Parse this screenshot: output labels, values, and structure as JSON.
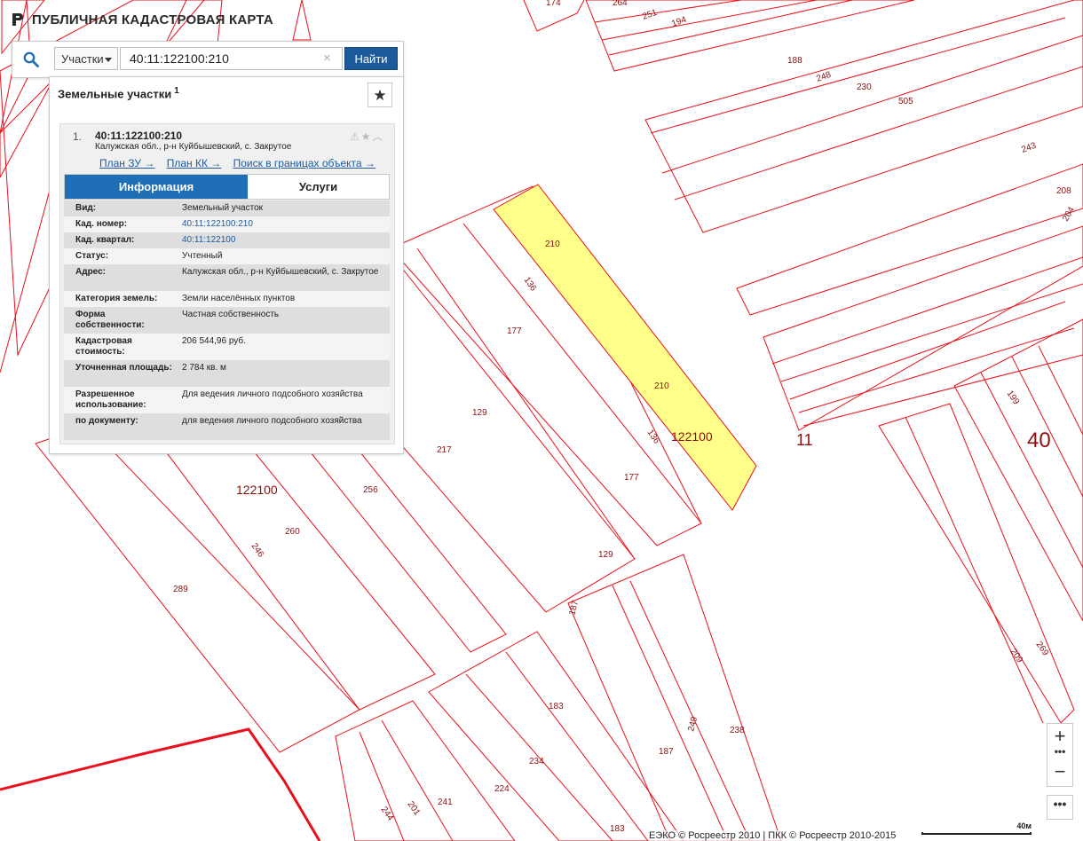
{
  "header": {
    "title": "ПУБЛИЧНАЯ КАДАСТРОВАЯ КАРТА"
  },
  "search": {
    "type": "Участки",
    "value": "40:11:122100:210",
    "button": "Найти",
    "clear": "×"
  },
  "panel": {
    "title": "Земельные участки",
    "count": "1",
    "item": {
      "num": "1.",
      "cad": "40:11:122100:210",
      "addr": "Калужская обл., р-н Куйбышевский, с. Закрутое",
      "links": [
        "План ЗУ →",
        "План КК →",
        "Поиск в границах объекта →"
      ]
    },
    "tabs": [
      "Информация",
      "Услуги"
    ],
    "rows": [
      {
        "k": "Вид:",
        "v": "Земельный участок"
      },
      {
        "k": "Кад. номер:",
        "v": "40:11:122100:210"
      },
      {
        "k": "Кад. квартал:",
        "v": "40:11:122100"
      },
      {
        "k": "Статус:",
        "v": "Учтенный"
      },
      {
        "k": "Адрес:",
        "v": "Калужская обл., р-н Куйбышевский, с. Закрутое"
      },
      {
        "k": "Категория земель:",
        "v": "Земли населённых пунктов"
      },
      {
        "k": "Форма собственности:",
        "v": "Частная собственность"
      },
      {
        "k": "Кадастровая стоимость:",
        "v": "206 544,96 руб."
      },
      {
        "k": "Уточненная площадь:",
        "v": "2 784 кв. м"
      },
      {
        "k": "Разрешенное использование:",
        "v": "Для ведения личного подсобного хозяйства"
      },
      {
        "k": "по документу:",
        "v": "для ведения личного подсобного хозяйства"
      }
    ]
  },
  "map": {
    "labels": [
      "174",
      "264",
      "251",
      "194",
      "188",
      "248",
      "230",
      "505",
      "243",
      "208",
      "204",
      "210",
      "136",
      "177",
      "210",
      "122100",
      "136",
      "177",
      "129",
      "129",
      "217",
      "256",
      "260",
      "122100",
      "246",
      "289",
      "11",
      "40",
      "199",
      "129",
      "187",
      "183",
      "234",
      "224",
      "241",
      "201",
      "244",
      "183",
      "187",
      "249",
      "238",
      "209",
      "269"
    ]
  },
  "footer": {
    "copyright": "ЕЭКО © Росреестр 2010 | ПКК © Росреестр 2010-2015",
    "scale": "40м"
  },
  "controls": {
    "zoom_in": "+",
    "zoom_out": "−",
    "more": "•••"
  }
}
